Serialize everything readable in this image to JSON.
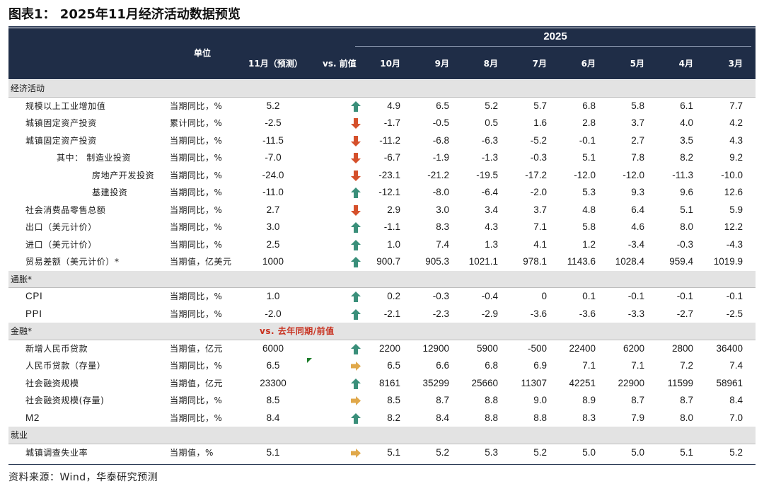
{
  "title": "图表1：  2025年11月经济活动数据预览",
  "header": {
    "unit_label": "单位",
    "year": "2025",
    "forecast_label": "11月（预测）",
    "vs_label": "vs. 前值",
    "months": [
      "10月",
      "9月",
      "8月",
      "7月",
      "6月",
      "5月",
      "4月",
      "3月"
    ]
  },
  "sections": [
    {
      "name": "经济活动",
      "rows": [
        {
          "label": "规模以上工业增加值",
          "unit": "当期同比，%",
          "forecast": "5.2",
          "arrow": "up",
          "values": [
            "4.9",
            "6.5",
            "5.2",
            "5.7",
            "6.8",
            "5.8",
            "6.1",
            "7.7"
          ]
        },
        {
          "label": "城镇固定资产投资",
          "unit": "累计同比，%",
          "forecast": "-2.5",
          "arrow": "down",
          "values": [
            "-1.7",
            "-0.5",
            "0.5",
            "1.6",
            "2.8",
            "3.7",
            "4.0",
            "4.2"
          ]
        },
        {
          "label": "城镇固定资产投资",
          "unit": "当期同比，%",
          "forecast": "-11.5",
          "arrow": "down",
          "values": [
            "-11.2",
            "-6.8",
            "-6.3",
            "-5.2",
            "-0.1",
            "2.7",
            "3.5",
            "4.3"
          ]
        },
        {
          "label": "其中：  制造业投资",
          "unit": "当期同比，%",
          "forecast": "-7.0",
          "arrow": "down",
          "values": [
            "-6.7",
            "-1.9",
            "-1.3",
            "-0.3",
            "5.1",
            "7.8",
            "8.2",
            "9.2"
          ]
        },
        {
          "label": "房地产开发投资",
          "unit": "当期同比，%",
          "forecast": "-24.0",
          "arrow": "down",
          "values": [
            "-23.1",
            "-21.2",
            "-19.5",
            "-17.2",
            "-12.0",
            "-12.0",
            "-11.3",
            "-10.0"
          ]
        },
        {
          "label": "基建投资",
          "unit": "当期同比，%",
          "forecast": "-11.0",
          "arrow": "up",
          "values": [
            "-12.1",
            "-8.0",
            "-6.4",
            "-2.0",
            "5.3",
            "9.3",
            "9.6",
            "12.6"
          ]
        },
        {
          "label": "社会消费品零售总额",
          "unit": "当期同比，%",
          "forecast": "2.7",
          "arrow": "down",
          "values": [
            "2.9",
            "3.0",
            "3.4",
            "3.7",
            "4.8",
            "6.4",
            "5.1",
            "5.9"
          ]
        },
        {
          "label": "出口（美元计价）",
          "unit": "当期同比，%",
          "forecast": "3.0",
          "arrow": "up",
          "values": [
            "-1.1",
            "8.3",
            "4.3",
            "7.1",
            "5.8",
            "4.6",
            "8.0",
            "12.2"
          ]
        },
        {
          "label": "进口（美元计价）",
          "unit": "当期同比，%",
          "forecast": "2.5",
          "arrow": "up",
          "values": [
            "1.0",
            "7.4",
            "1.3",
            "4.1",
            "1.2",
            "-3.4",
            "-0.3",
            "-4.3"
          ]
        },
        {
          "label": "贸易差额（美元计价）*",
          "unit": "当期值，亿美元",
          "forecast": "1000",
          "arrow": "up",
          "values": [
            "900.7",
            "905.3",
            "1021.1",
            "978.1",
            "1143.6",
            "1028.4",
            "959.4",
            "1019.9"
          ]
        }
      ]
    },
    {
      "name": "通胀*",
      "rows": [
        {
          "label": "CPI",
          "unit": "当期同比，%",
          "forecast": "1.0",
          "arrow": "up",
          "values": [
            "0.2",
            "-0.3",
            "-0.4",
            "0",
            "0.1",
            "-0.1",
            "-0.1",
            "-0.1"
          ]
        },
        {
          "label": "PPI",
          "unit": "当期同比，%",
          "forecast": "-2.0",
          "arrow": "up",
          "values": [
            "-2.1",
            "-2.3",
            "-2.9",
            "-3.6",
            "-3.6",
            "-3.3",
            "-2.7",
            "-2.5"
          ]
        }
      ]
    },
    {
      "name": "金融*",
      "note": "vs.  去年同期/前值",
      "rows": [
        {
          "label": "新增人民币贷款",
          "unit": "当期值，亿元",
          "forecast": "6000",
          "arrow": "up",
          "values": [
            "2200",
            "12900",
            "5900",
            "-500",
            "22400",
            "6200",
            "2800",
            "36400"
          ]
        },
        {
          "label": "人民币贷款（存量）",
          "unit": "当期同比，%",
          "forecast": "6.5",
          "arrow": "flat",
          "values": [
            "6.5",
            "6.6",
            "6.8",
            "6.9",
            "7.1",
            "7.1",
            "7.2",
            "7.4"
          ]
        },
        {
          "label": "社会融资规模",
          "unit": "当期值，亿元",
          "forecast": "23300",
          "arrow": "up",
          "values": [
            "8161",
            "35299",
            "25660",
            "11307",
            "42251",
            "22900",
            "11599",
            "58961"
          ]
        },
        {
          "label": "社会融资规模(存量)",
          "unit": "当期同比，%",
          "forecast": "8.5",
          "arrow": "flat",
          "values": [
            "8.5",
            "8.7",
            "8.8",
            "9.0",
            "8.9",
            "8.7",
            "8.7",
            "8.4"
          ]
        },
        {
          "label": "M2",
          "unit": "当期同比，%",
          "forecast": "8.4",
          "arrow": "up",
          "values": [
            "8.2",
            "8.4",
            "8.8",
            "8.8",
            "8.3",
            "7.9",
            "8.0",
            "7.0"
          ]
        }
      ]
    },
    {
      "name": "就业",
      "rows": [
        {
          "label": "城镇调查失业率",
          "unit": "当期值，%",
          "forecast": "5.1",
          "arrow": "flat",
          "values": [
            "5.1",
            "5.2",
            "5.3",
            "5.2",
            "5.0",
            "5.0",
            "5.1",
            "5.2"
          ]
        }
      ]
    }
  ],
  "source": "资料来源：Wind，华泰研究预测",
  "colors": {
    "header_bg": "#1f2d47",
    "section_bg": "#e3e3e3",
    "arrow_up": "#3a8f7a",
    "arrow_down": "#d5502b",
    "arrow_flat": "#e0a84a",
    "note_red": "#c8301e"
  },
  "icons": {
    "up": "up-arrow-icon",
    "down": "down-arrow-icon",
    "flat": "right-arrow-icon"
  }
}
